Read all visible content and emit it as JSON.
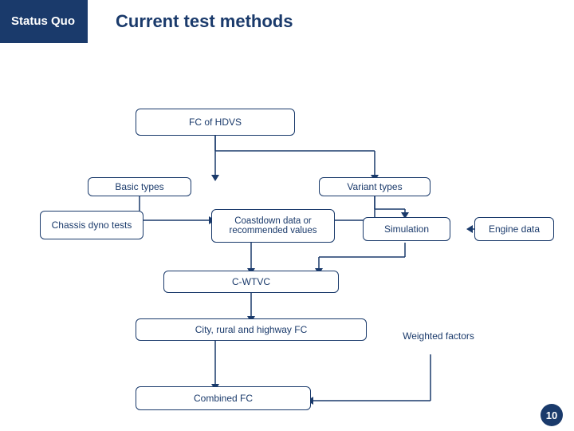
{
  "header": {
    "status_label": "Status Quo",
    "title": "Current test methods"
  },
  "page_number": "10",
  "flowchart": {
    "fc_hdvs": "FC of HDVS",
    "basic_types": "Basic types",
    "variant_types": "Variant types",
    "chassis_dyno": "Chassis dyno tests",
    "coastdown": "Coastdown data or\nrecommended values",
    "simulation": "Simulation",
    "engine_data": "Engine data",
    "cwtvc": "C-WTVC",
    "city_rural": "City, rural and highway FC",
    "weighted_factors": "Weighted factors",
    "combined_fc": "Combined FC"
  }
}
